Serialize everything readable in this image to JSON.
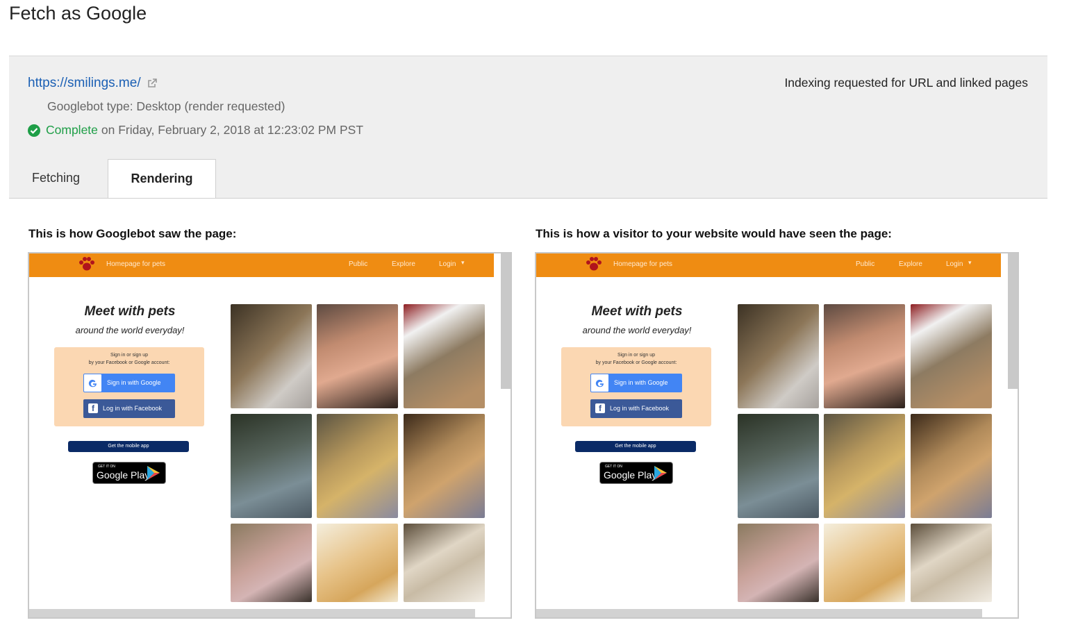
{
  "page": {
    "title": "Fetch as Google"
  },
  "result": {
    "url": "https://smilings.me/",
    "googlebot_type": "Googlebot type: Desktop (render requested)",
    "status": "Complete",
    "status_detail": "on Friday, February 2, 2018 at 12:23:02 PM PST",
    "indexing": "Indexing requested for URL and linked pages"
  },
  "tabs": [
    {
      "label": "Fetching",
      "selected": false
    },
    {
      "label": "Rendering",
      "selected": true
    }
  ],
  "captions": {
    "googlebot": "This is how Googlebot saw the page:",
    "visitor": "This is how a visitor to your website would have seen the page:"
  },
  "site": {
    "tagline": "Homepage for pets",
    "nav": [
      "Public",
      "Explore",
      "Login"
    ],
    "hero_title": "Meet with pets",
    "hero_sub": "around the world everyday!",
    "signin_line1": "Sign in or sign up",
    "signin_line2": "by your Facebook or Google account:",
    "google_btn": "Sign in with Google",
    "facebook_btn": "Log in with Facebook",
    "mobile_app": "Get the mobile app",
    "play_get": "GET IT ON",
    "play_name": "Google Play",
    "photos": [
      "rabbit-on-bed",
      "person-with-rabbit",
      "rabbit-by-flag",
      "dark-bedroom",
      "rabbit-closeup",
      "rabbit-sitting",
      "sleeping-dog",
      "puppy",
      "fluffy-dog"
    ]
  },
  "colors": {
    "link": "#1a5fb4",
    "complete": "#1e9e47",
    "site_header": "#ef8c12",
    "google_blue": "#4285f4",
    "facebook_blue": "#3b5998"
  }
}
